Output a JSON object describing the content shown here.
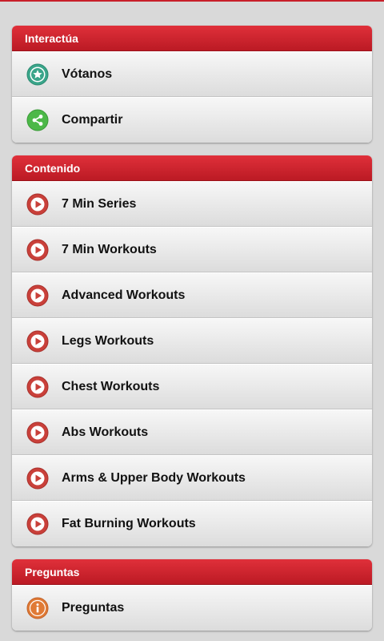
{
  "sections": [
    {
      "header": "Interactúa",
      "items": [
        {
          "label": "Vótanos",
          "icon": "star-badge-icon"
        },
        {
          "label": "Compartir",
          "icon": "share-icon"
        }
      ]
    },
    {
      "header": "Contenido",
      "items": [
        {
          "label": "7 Min Series",
          "icon": "play-icon"
        },
        {
          "label": "7 Min Workouts",
          "icon": "play-icon"
        },
        {
          "label": "Advanced Workouts",
          "icon": "play-icon"
        },
        {
          "label": "Legs Workouts",
          "icon": "play-icon"
        },
        {
          "label": "Chest Workouts",
          "icon": "play-icon"
        },
        {
          "label": "Abs Workouts",
          "icon": "play-icon"
        },
        {
          "label": "Arms & Upper Body Workouts",
          "icon": "play-icon"
        },
        {
          "label": "Fat Burning Workouts",
          "icon": "play-icon"
        }
      ]
    },
    {
      "header": "Preguntas",
      "items": [
        {
          "label": "Preguntas",
          "icon": "info-icon"
        }
      ]
    }
  ],
  "colors": {
    "accent": "#d2232d",
    "background": "#d9d9d9",
    "star_icon": "#3aa58a",
    "share_icon": "#4cb848",
    "play_icon": "#c9403a",
    "info_icon": "#e07a35"
  }
}
